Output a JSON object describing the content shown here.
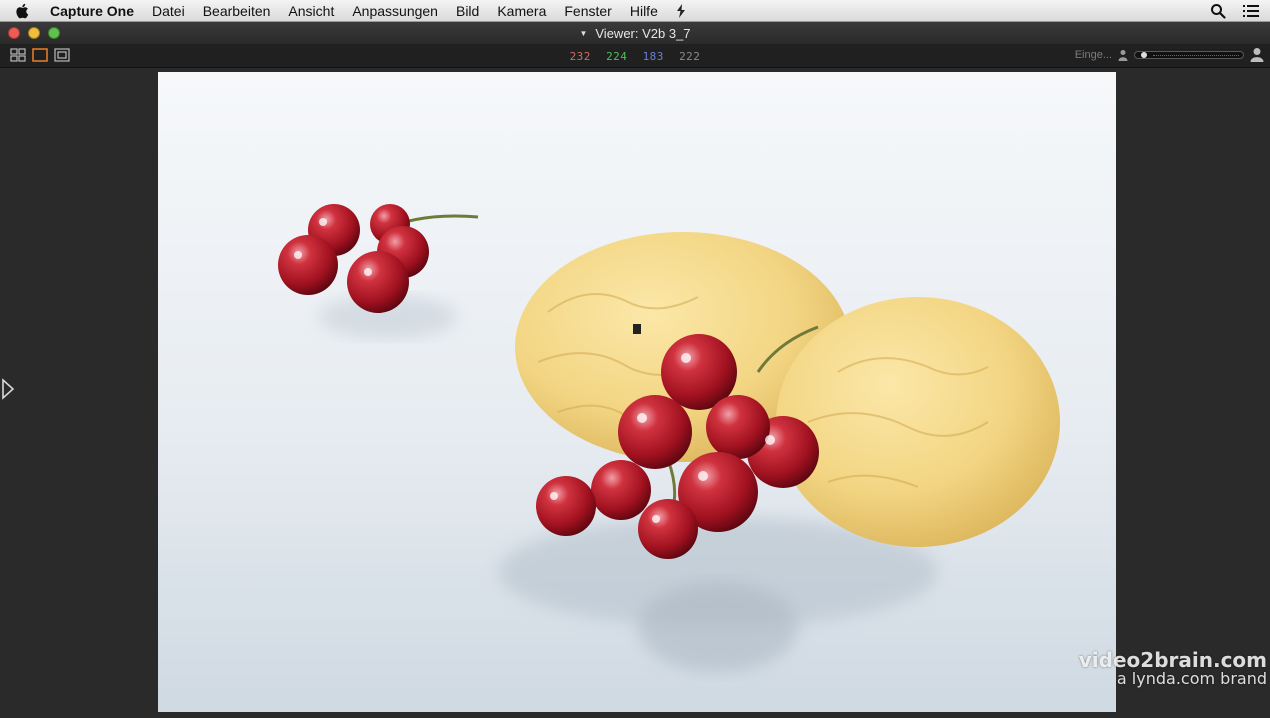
{
  "menubar": {
    "apple_icon": "apple-icon",
    "app_name": "Capture One",
    "items": [
      "Datei",
      "Bearbeiten",
      "Ansicht",
      "Anpassungen",
      "Bild",
      "Kamera",
      "Fenster",
      "Hilfe"
    ],
    "right_icons": [
      "search-icon",
      "list-icon"
    ]
  },
  "window": {
    "title": "Viewer: V2b 3_7"
  },
  "toolbar": {
    "view_modes": [
      "grid-view",
      "single-view",
      "compare-view"
    ],
    "rgb_readout": {
      "r": "232",
      "g": "224",
      "b": "183",
      "l": "222"
    },
    "zoom_label": "Einge...",
    "colors": {
      "r": "#d46a5e",
      "g": "#4fbf5a",
      "b": "#6b7fd4",
      "l": "#8a8a8a"
    }
  },
  "viewer": {
    "watermark_line1": "video2brain.com",
    "watermark_line2": "a lynda.com brand"
  }
}
